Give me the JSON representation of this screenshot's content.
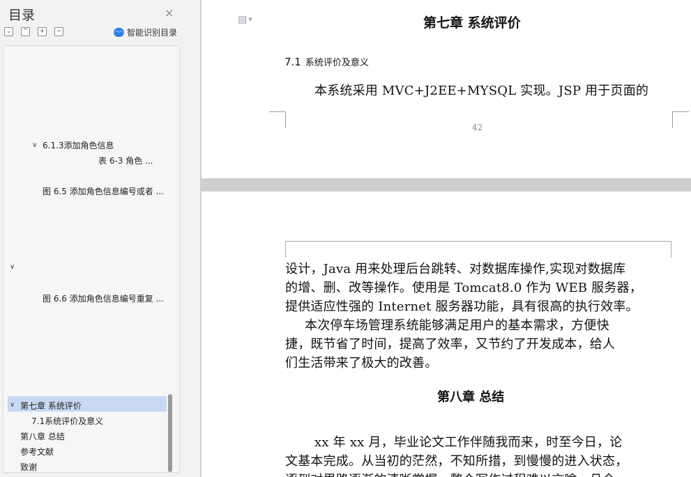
{
  "sidebar": {
    "title": "目录",
    "close_glyph": "×",
    "tools": {
      "collapse_all": "⌄",
      "expand_all": "⌃",
      "add": "+",
      "remove": "−"
    },
    "smart_toc_label": "智能识别目录",
    "smart_toc_icon": "ai-cloud-icon",
    "toc": {
      "item_613": "6.1.3添加角色信息",
      "item_table63": "表  6-3  角色 ...",
      "item_fig65": "图 6.5  添加角色信息编号或者 ...",
      "item_fig66": "图 6.6 添加角色信息编号重复 ...",
      "item_ch7": "第七章  系统评价",
      "item_71": "7.1系统评价及意义",
      "item_ch8": "第八章  总结",
      "item_refs": "参考文献",
      "item_thanks": "致谢"
    },
    "active_color": "#c9d8f3"
  },
  "document": {
    "page1": {
      "chapter_title": "第七章    系统评价",
      "section_number": "7.1",
      "section_title": "系统评价及意义",
      "body_line1": "本系统采用 MVC+J2EE+MYSQL 实现。JSP 用于页面的",
      "page_number": "42"
    },
    "page2": {
      "line1": "设计，Java 用来处理后台跳转、对数据库操作,实现对数据库",
      "line2": "的增、删、改等操作。使用是 Tomcat8.0 作为 WEB 服务器，",
      "line3": "提供适应性强的 Internet 服务器功能，具有很高的执行效率。",
      "line4": "本次停车场管理系统能够满足用户的基本需求，方便快",
      "line5": "捷，既节省了时间，提高了效率，又节约了开发成本，给人",
      "line6": "们生活带来了极大的改善。",
      "chapter8_title": "第八章    总结",
      "line7": "xx 年 xx 月，毕业论文工作伴随我而来，时至今日，论",
      "line8": "文基本完成。从当初的茫然，不知所措，到慢慢的进入状态，",
      "line9": "逐到对思路逐渐的清晰掌握，整个写作过程难以言喻。且今"
    }
  }
}
